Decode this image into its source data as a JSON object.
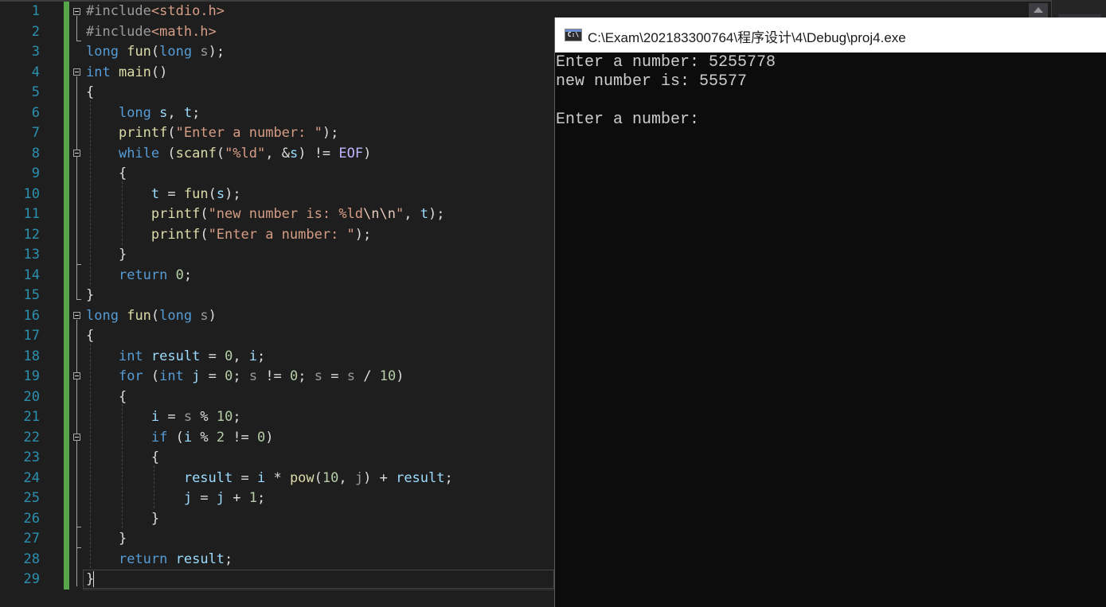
{
  "editor": {
    "line_numbers": [
      "1",
      "2",
      "3",
      "4",
      "5",
      "6",
      "7",
      "8",
      "9",
      "10",
      "11",
      "12",
      "13",
      "14",
      "15",
      "16",
      "17",
      "18",
      "19",
      "20",
      "21",
      "22",
      "23",
      "24",
      "25",
      "26",
      "27",
      "28",
      "29"
    ],
    "code": {
      "l1": [
        "#include",
        "<stdio.h>"
      ],
      "l2": [
        "#include",
        "<math.h>"
      ],
      "l3": [
        "long",
        " ",
        "fun",
        "(",
        "long",
        " ",
        "s",
        ");"
      ],
      "l4": [
        "int",
        " ",
        "main",
        "()"
      ],
      "l5": [
        "{"
      ],
      "l6": [
        "    ",
        "long",
        " ",
        "s",
        ", ",
        "t",
        ";"
      ],
      "l7": [
        "    ",
        "printf",
        "(",
        "\"Enter a number: \"",
        ");"
      ],
      "l8": [
        "    ",
        "while",
        " (",
        "scanf",
        "(",
        "\"%ld\"",
        ", &",
        "s",
        ") != ",
        "EOF",
        ")"
      ],
      "l9": [
        "    {"
      ],
      "l10": [
        "        ",
        "t",
        " = ",
        "fun",
        "(",
        "s",
        ");"
      ],
      "l11": [
        "        ",
        "printf",
        "(",
        "\"new number is: %ld",
        "\\n\\n",
        "\"",
        ", ",
        "t",
        ");"
      ],
      "l12": [
        "        ",
        "printf",
        "(",
        "\"Enter a number: \"",
        ");"
      ],
      "l13": [
        "    }"
      ],
      "l14": [
        "    ",
        "return",
        " ",
        "0",
        ";"
      ],
      "l15": [
        "}"
      ],
      "l16": [
        "long",
        " ",
        "fun",
        "(",
        "long",
        " ",
        "s",
        ")"
      ],
      "l17": [
        "{"
      ],
      "l18": [
        "    ",
        "int",
        " ",
        "result",
        " = ",
        "0",
        ", ",
        "i",
        ";"
      ],
      "l19": [
        "    ",
        "for",
        " (",
        "int",
        " ",
        "j",
        " = ",
        "0",
        "; ",
        "s",
        " != ",
        "0",
        "; ",
        "s",
        " = ",
        "s",
        " / ",
        "10",
        ")"
      ],
      "l20": [
        "    {"
      ],
      "l21": [
        "        ",
        "i",
        " = ",
        "s",
        " % ",
        "10",
        ";"
      ],
      "l22": [
        "        ",
        "if",
        " (",
        "i",
        " % ",
        "2",
        " != ",
        "0",
        ")"
      ],
      "l23": [
        "        {"
      ],
      "l24": [
        "            ",
        "result",
        " = ",
        "i",
        " * ",
        "pow",
        "(",
        "10",
        ", ",
        "j",
        ") + ",
        "result",
        ";"
      ],
      "l25": [
        "            ",
        "j",
        " = ",
        "j",
        " + ",
        "1",
        ";"
      ],
      "l26": [
        "        }"
      ],
      "l27": [
        "    }"
      ],
      "l28": [
        "    ",
        "return",
        " ",
        "result",
        ";"
      ],
      "l29": [
        "}"
      ]
    }
  },
  "console": {
    "title": "C:\\Exam\\202183300764\\程序设计\\4\\Debug\\proj4.exe",
    "icon_label": "C:\\",
    "lines": [
      "Enter a number: 5255778",
      "new number is: 55577",
      "",
      "Enter a number: "
    ]
  },
  "colors": {
    "line_number": "#2b91af",
    "keyword": "#569cd6",
    "function": "#dcdcaa",
    "string": "#d69d85",
    "number": "#b5cea8",
    "change_bar": "#57a64a",
    "console_bg": "#0c0c0c"
  }
}
